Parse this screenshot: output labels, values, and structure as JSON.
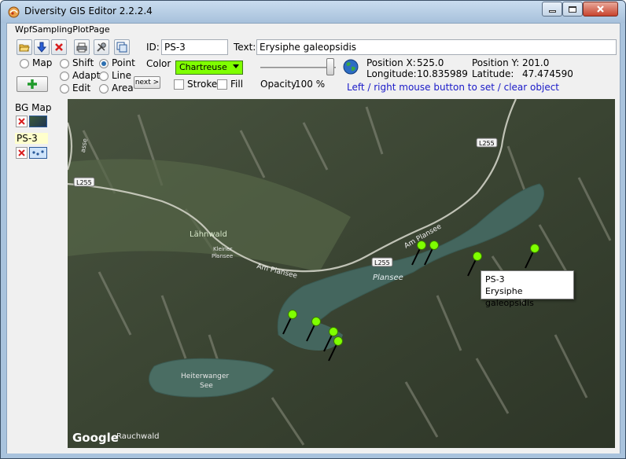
{
  "window": {
    "title": "Diversity GIS Editor 2.2.2.4"
  },
  "tab": {
    "label": "WpfSamplingPlotPage"
  },
  "toolbar": {
    "icons": [
      "open-folder-icon",
      "save-down-icon",
      "delete-x-icon",
      "print-icon",
      "settings-tools-icon",
      "copy-window-icon"
    ]
  },
  "fields": {
    "id_label": "ID:",
    "id_value": "PS-3",
    "text_label": "Text:",
    "text_value": "Erysiphe galeopsidis"
  },
  "mode": {
    "map": "Map",
    "shift": "Shift",
    "adapt": "Adapt",
    "edit": "Edit",
    "selected": "Map"
  },
  "geometry": {
    "point": "Point",
    "line": "Line",
    "area": "Area",
    "selected": "Point"
  },
  "style": {
    "color_label": "Color",
    "color_value": "Chartreuse",
    "color_hex": "#7fff00",
    "stroke_label": "Stroke",
    "fill_label": "Fill",
    "next_label": "next >",
    "opacity_label": "Opacity",
    "opacity_value": "100 %",
    "opacity_fraction": 1.0
  },
  "position": {
    "x_label": "Position X:",
    "x_value": "525.0",
    "y_label": "Position Y:",
    "y_value": "201.0",
    "lon_label": "Longitude:",
    "lon_value": "10.835989",
    "lat_label": "Latitude:",
    "lat_value": "47.474590",
    "hint": "Left / right mouse button to set / clear object"
  },
  "layers": {
    "bg_label": "BG Map",
    "layer_label": "PS-3"
  },
  "map": {
    "labels": {
      "road_l255": "L255",
      "am_plansee": "Am Plansee",
      "lahnwald": "Lähnwald",
      "kleiner": "Kleiner",
      "plansee_small": "Plansee",
      "plansee": "Plansee",
      "heiterwanger": "Heiterwanger",
      "see": "See",
      "rauchwald": "Rauchwald",
      "google": "Google",
      "partial_top": "asse"
    },
    "tooltip": {
      "id": "PS-3",
      "text": "Erysiphe galeopsidis"
    },
    "marker_color": "#7fff00"
  }
}
